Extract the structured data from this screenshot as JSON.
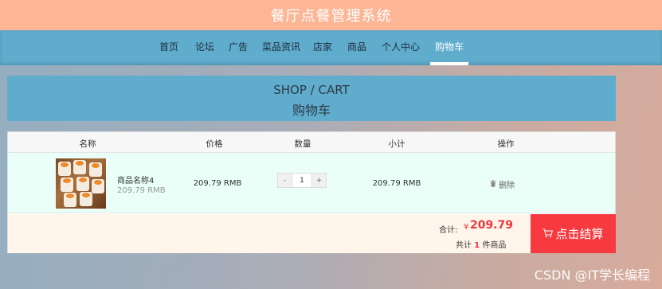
{
  "app": {
    "title": "餐厅点餐管理系统"
  },
  "nav": {
    "items": [
      {
        "label": "首页"
      },
      {
        "label": "论坛"
      },
      {
        "label": "广告"
      },
      {
        "label": "菜品资讯"
      },
      {
        "label": "店家"
      },
      {
        "label": "商品"
      },
      {
        "label": "个人中心"
      },
      {
        "label": "购物车",
        "active": true
      }
    ]
  },
  "banner": {
    "title_en": "SHOP / CART",
    "title_cn": "购物车"
  },
  "cart": {
    "columns": [
      "名称",
      "价格",
      "数量",
      "小计",
      "操作"
    ],
    "items": [
      {
        "name": "商品名称4",
        "price_sub": "209.79 RMB",
        "price": "209.79 RMB",
        "quantity": "1",
        "decrement_label": "-",
        "increment_label": "+",
        "subtotal": "209.79 RMB",
        "delete_label": "删除"
      }
    ],
    "footer": {
      "total_label": "合计:",
      "currency": "¥",
      "total_value": "209.79",
      "count_prefix": "共计",
      "count": "1",
      "count_suffix": "件商品",
      "checkout_label": "点击结算"
    }
  },
  "watermark": "CSDN @IT学长编程",
  "colors": {
    "accent_red": "#f73a3f",
    "nav_blue": "#5faccd",
    "header_peach": "#fcb595"
  },
  "icons": {
    "delete": "trash-icon",
    "checkout": "cart-icon"
  }
}
